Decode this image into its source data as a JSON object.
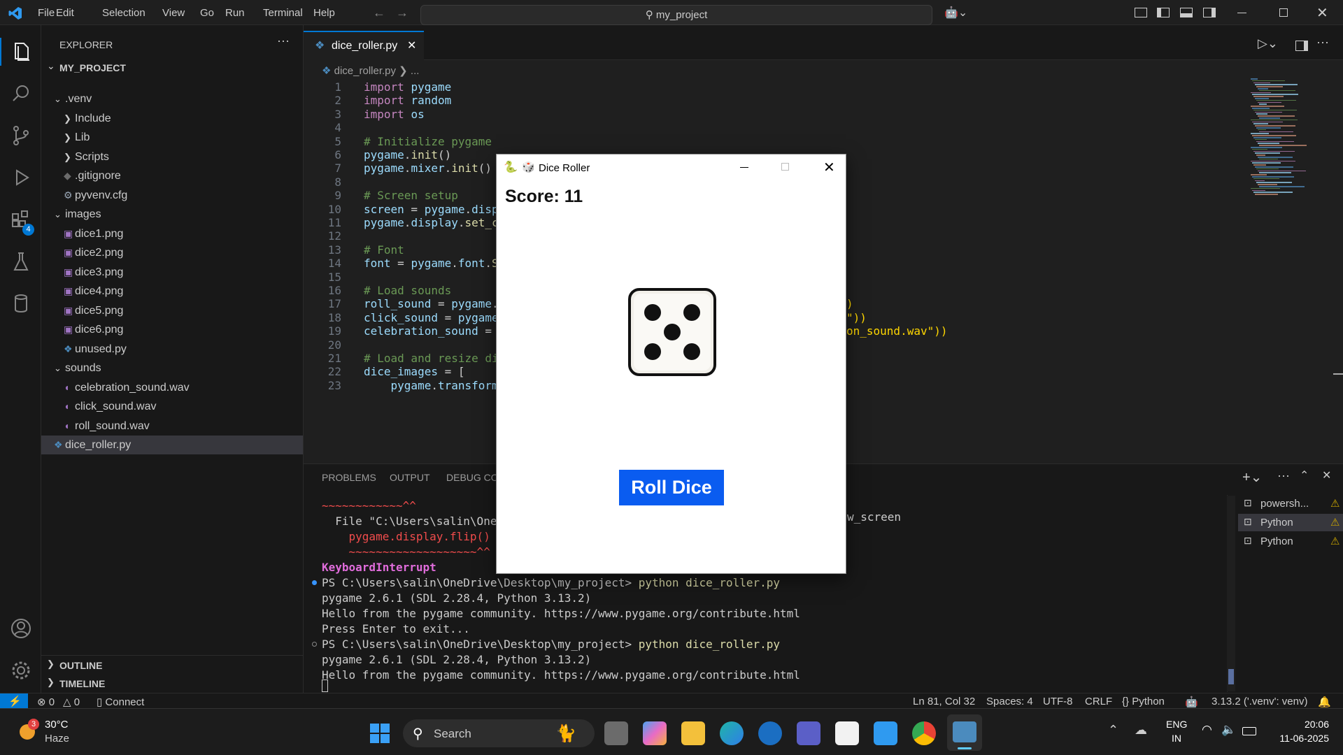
{
  "menu": [
    "File",
    "Edit",
    "Selection",
    "View",
    "Go",
    "Run",
    "Terminal",
    "Help"
  ],
  "search": {
    "text": "my_project"
  },
  "explorer": {
    "header": "EXPLORER",
    "project": "MY_PROJECT",
    "items": [
      {
        "label": ".venv",
        "kind": "folder-open",
        "depth": 1
      },
      {
        "label": "Include",
        "kind": "folder",
        "depth": 2
      },
      {
        "label": "Lib",
        "kind": "folder",
        "depth": 2
      },
      {
        "label": "Scripts",
        "kind": "folder",
        "depth": 2
      },
      {
        "label": ".gitignore",
        "kind": "git",
        "depth": 2
      },
      {
        "label": "pyvenv.cfg",
        "kind": "gear",
        "depth": 2
      },
      {
        "label": "images",
        "kind": "folder-open",
        "depth": 1
      },
      {
        "label": "dice1.png",
        "kind": "image",
        "depth": 2
      },
      {
        "label": "dice2.png",
        "kind": "image",
        "depth": 2
      },
      {
        "label": "dice3.png",
        "kind": "image",
        "depth": 2
      },
      {
        "label": "dice4.png",
        "kind": "image",
        "depth": 2
      },
      {
        "label": "dice5.png",
        "kind": "image",
        "depth": 2
      },
      {
        "label": "dice6.png",
        "kind": "image",
        "depth": 2
      },
      {
        "label": "unused.py",
        "kind": "python",
        "depth": 2
      },
      {
        "label": "sounds",
        "kind": "folder-open",
        "depth": 1
      },
      {
        "label": "celebration_sound.wav",
        "kind": "audio",
        "depth": 2
      },
      {
        "label": "click_sound.wav",
        "kind": "audio",
        "depth": 2
      },
      {
        "label": "roll_sound.wav",
        "kind": "audio",
        "depth": 2
      },
      {
        "label": "dice_roller.py",
        "kind": "python",
        "depth": 1
      }
    ],
    "outline": "OUTLINE",
    "timeline": "TIMELINE",
    "extensions_badge": "4"
  },
  "editor": {
    "tab": "dice_roller.py",
    "breadcrumb_file": "dice_roller.py",
    "breadcrumb_rest": "...",
    "lines": [
      {
        "n": "1",
        "parts": [
          [
            "kw",
            "import "
          ],
          [
            "vr",
            "pygame"
          ]
        ]
      },
      {
        "n": "2",
        "parts": [
          [
            "kw",
            "import "
          ],
          [
            "vr",
            "random"
          ]
        ]
      },
      {
        "n": "3",
        "parts": [
          [
            "kw",
            "import "
          ],
          [
            "vr",
            "os"
          ]
        ]
      },
      {
        "n": "4",
        "parts": []
      },
      {
        "n": "5",
        "parts": [
          [
            "cm",
            "# Initialize pygame"
          ]
        ]
      },
      {
        "n": "6",
        "parts": [
          [
            "vr",
            "pygame"
          ],
          [
            "",
            "."
          ],
          [
            "fn",
            "init"
          ],
          [
            "",
            "()"
          ]
        ]
      },
      {
        "n": "7",
        "parts": [
          [
            "vr",
            "pygame"
          ],
          [
            "",
            "."
          ],
          [
            "vr",
            "mixer"
          ],
          [
            "",
            "."
          ],
          [
            "fn",
            "init"
          ],
          [
            "",
            "()"
          ]
        ]
      },
      {
        "n": "8",
        "parts": []
      },
      {
        "n": "9",
        "parts": [
          [
            "cm",
            "# Screen setup"
          ]
        ]
      },
      {
        "n": "10",
        "parts": [
          [
            "vr",
            "screen"
          ],
          [
            "",
            " = "
          ],
          [
            "vr",
            "pygame"
          ],
          [
            "",
            "."
          ],
          [
            "vr",
            "disp"
          ]
        ]
      },
      {
        "n": "11",
        "parts": [
          [
            "vr",
            "pygame"
          ],
          [
            "",
            "."
          ],
          [
            "vr",
            "display"
          ],
          [
            "",
            "."
          ],
          [
            "fn",
            "set_c"
          ]
        ]
      },
      {
        "n": "12",
        "parts": []
      },
      {
        "n": "13",
        "parts": [
          [
            "cm",
            "# Font"
          ]
        ]
      },
      {
        "n": "14",
        "parts": [
          [
            "vr",
            "font"
          ],
          [
            "",
            " = "
          ],
          [
            "vr",
            "pygame"
          ],
          [
            "",
            "."
          ],
          [
            "vr",
            "font"
          ],
          [
            "",
            "."
          ],
          [
            "fn",
            "S"
          ]
        ]
      },
      {
        "n": "15",
        "parts": []
      },
      {
        "n": "16",
        "parts": [
          [
            "cm",
            "# Load sounds"
          ]
        ]
      },
      {
        "n": "17",
        "parts": [
          [
            "vr",
            "roll_sound"
          ],
          [
            "",
            " = "
          ],
          [
            "vr",
            "pygame"
          ],
          [
            "",
            "."
          ]
        ]
      },
      {
        "n": "18",
        "parts": [
          [
            "vr",
            "click_sound"
          ],
          [
            "",
            " = "
          ],
          [
            "vr",
            "pygame"
          ]
        ]
      },
      {
        "n": "19",
        "parts": [
          [
            "vr",
            "celebration_sound"
          ],
          [
            "",
            " = "
          ]
        ]
      },
      {
        "n": "20",
        "parts": []
      },
      {
        "n": "21",
        "parts": [
          [
            "cm",
            "# Load and resize di"
          ]
        ]
      },
      {
        "n": "22",
        "parts": [
          [
            "vr",
            "dice_images"
          ],
          [
            "",
            " = ["
          ]
        ]
      },
      {
        "n": "23",
        "parts": [
          [
            "",
            "    "
          ],
          [
            "vr",
            "pygame"
          ],
          [
            "",
            "."
          ],
          [
            "vr",
            "transform"
          ]
        ]
      }
    ],
    "right_fragments": [
      {
        "line": 17,
        "text": ")"
      },
      {
        "line": 18,
        "text": "\"))"
      },
      {
        "line": 19,
        "text": "on_sound.wav\"))"
      }
    ]
  },
  "panel": {
    "tabs": [
      "PROBLEMS",
      "OUTPUT",
      "DEBUG CON"
    ],
    "terminal": [
      {
        "cls": "err",
        "text": "~~~~~~~~~~~~^^"
      },
      {
        "cls": "plain",
        "text": "  File \"C:\\Users\\salin\\OneDr"
      },
      {
        "cls": "err",
        "text": "    pygame.display.flip()"
      },
      {
        "cls": "err",
        "text": "    ~~~~~~~~~~~~~~~~~~~^^"
      },
      {
        "cls": "kbi",
        "text": "KeyboardInterrupt"
      },
      {
        "cls": "prompt",
        "text": "PS C:\\Users\\salin\\OneDrive\\Desktop\\my_project> ",
        "cmd": "python dice_roller.py"
      },
      {
        "cls": "plain",
        "text": "pygame 2.6.1 (SDL 2.28.4, Python 3.13.2)"
      },
      {
        "cls": "plain",
        "text": "Hello from the pygame community. https://www.pygame.org/contribute.html"
      },
      {
        "cls": "plain",
        "text": "Press Enter to exit..."
      },
      {
        "cls": "prompt",
        "text": "PS C:\\Users\\salin\\OneDrive\\Desktop\\my_project> ",
        "cmd": "python dice_roller.py"
      },
      {
        "cls": "plain",
        "text": "pygame 2.6.1 (SDL 2.28.4, Python 3.13.2)"
      },
      {
        "cls": "plain",
        "text": "Hello from the pygame community. https://www.pygame.org/contribute.html"
      }
    ],
    "file_line_tail": "w_screen",
    "terminals": [
      "powersh...",
      "Python",
      "Python"
    ]
  },
  "statusbar": {
    "errors": "0",
    "warnings": "0",
    "connect": "Connect",
    "position": "Ln 81, Col 32",
    "spaces": "Spaces: 4",
    "encoding": "UTF-8",
    "eol": "CRLF",
    "language": "Python",
    "interpreter": "3.13.2 ('.venv': venv)"
  },
  "game": {
    "title": "Dice Roller",
    "score_label": "Score: 11",
    "die_value": 5,
    "button": "Roll Dice",
    "accent": "#0a5cf0"
  },
  "taskbar": {
    "weather_temp": "30°C",
    "weather_desc": "Haze",
    "weather_badge": "3",
    "search": "Search",
    "lang1": "ENG",
    "lang2": "IN",
    "time": "20:06",
    "date": "11-06-2025"
  }
}
